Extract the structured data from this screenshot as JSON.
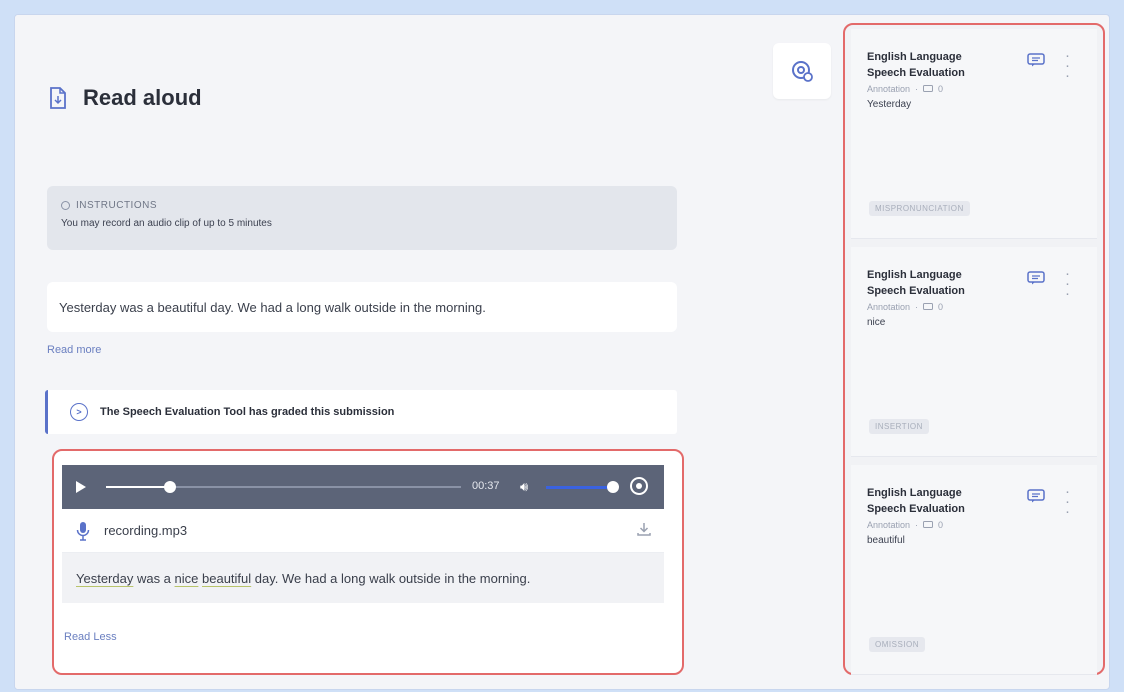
{
  "page": {
    "title": "Read aloud"
  },
  "instructions": {
    "heading": "INSTRUCTIONS",
    "text": "You may record an audio clip of up to 5 minutes"
  },
  "passage": {
    "text": "Yesterday was a beautiful day. We had a long walk outside in the morning.",
    "read_more": "Read more"
  },
  "graded_banner": {
    "text": "The Speech Evaluation Tool has graded this submission"
  },
  "recording": {
    "player": {
      "time": "00:37",
      "progress": 0.18,
      "volume": 0.95
    },
    "file_name": "recording.mp3",
    "transcript": {
      "segments": [
        {
          "text": "Yesterday",
          "highlight": true
        },
        {
          "text": " was a ",
          "highlight": false
        },
        {
          "text": "nice",
          "highlight": true
        },
        {
          "text": " ",
          "highlight": false
        },
        {
          "text": "beautiful",
          "highlight": true
        },
        {
          "text": " day. We had a long walk outside in the morning.",
          "highlight": false
        }
      ]
    },
    "read_less": "Read Less"
  },
  "annotations": [
    {
      "title": "English Language Speech Evaluation",
      "type": "Annotation",
      "comment_count": "0",
      "word": "Yesterday",
      "tag": "MISPRONUNCIATION"
    },
    {
      "title": "English Language Speech Evaluation",
      "type": "Annotation",
      "comment_count": "0",
      "word": "nice",
      "tag": "INSERTION"
    },
    {
      "title": "English Language Speech Evaluation",
      "type": "Annotation",
      "comment_count": "0",
      "word": "beautiful",
      "tag": "OMISSION"
    }
  ],
  "colors": {
    "accent": "#5a72c9",
    "highlight_border": "#e36a6a",
    "player_bg": "#5c6478",
    "volume": "#3a62e0"
  }
}
